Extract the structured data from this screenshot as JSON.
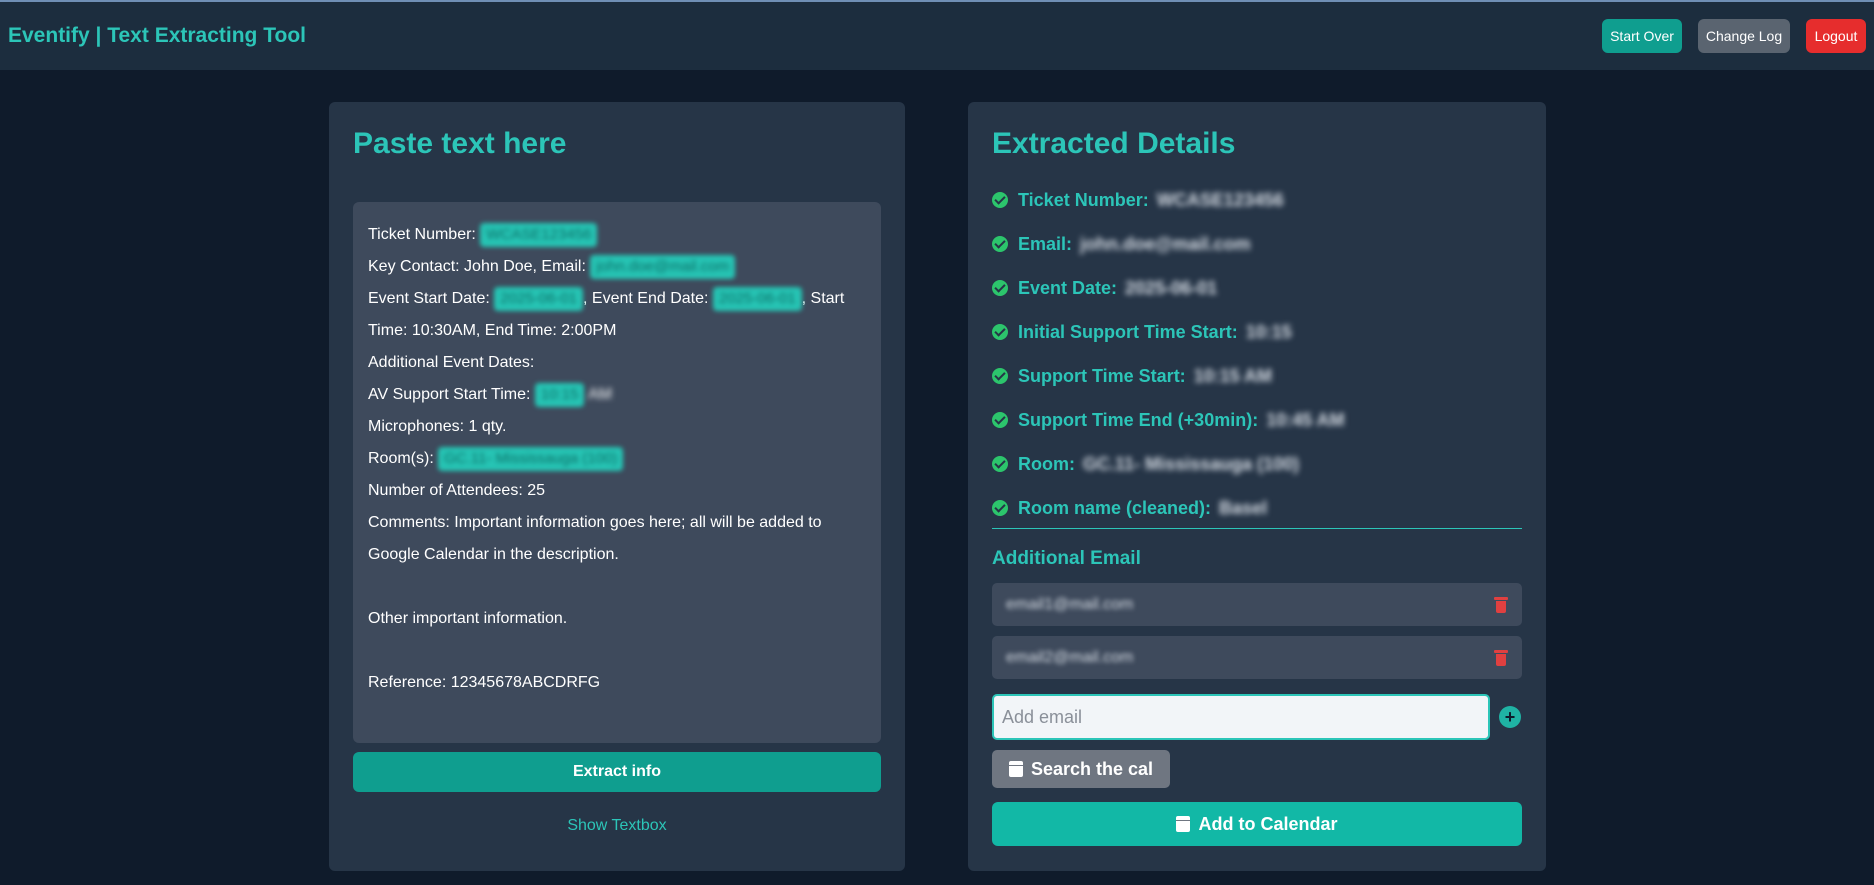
{
  "app": {
    "title": "Eventify | Text Extracting Tool"
  },
  "nav": {
    "start_over": "Start Over",
    "change_log": "Change Log",
    "logout": "Logout"
  },
  "left": {
    "title": "Paste text here",
    "lines": {
      "ticket_label": "Ticket Number:",
      "ticket_value": "WCASE123456",
      "contact_label": "Key Contact: John Doe, Email:",
      "contact_email": "john.doe@mail.com",
      "start_label": "Event Start Date:",
      "start_value": "2025-06-01",
      "end_label": ", Event End Date:",
      "end_value": "2025-06-01",
      "start_suffix": ", Start",
      "time_line": "Time: 10:30AM, End Time: 2:00PM",
      "additional_dates": "Additional Event Dates:",
      "av_label": "AV Support Start Time:",
      "av_value": "10:15",
      "av_suffix": "AM",
      "mics": "Microphones: 1 qty.",
      "rooms_label": "Room(s):",
      "rooms_value": "GC.11- Mississauga (100)",
      "attendees": "Number of Attendees: 25",
      "comments": "Comments: Important information goes here; all will be added to Google Calendar in the description.",
      "other": "Other important information.",
      "reference": "Reference: 12345678ABCDRFG"
    },
    "extract_button": "Extract info",
    "show_textbox": "Show Textbox"
  },
  "right": {
    "title": "Extracted Details",
    "details": [
      {
        "label": "Ticket Number:",
        "value": "WCASE123456"
      },
      {
        "label": "Email:",
        "value": "john.doe@mail.com"
      },
      {
        "label": "Event Date:",
        "value": "2025-06-01"
      },
      {
        "label": "Initial Support Time Start:",
        "value": "10:15"
      },
      {
        "label": "Support Time Start:",
        "value": "10:15 AM"
      },
      {
        "label": "Support Time End (+30min):",
        "value": "10:45 AM"
      },
      {
        "label": "Room:",
        "value": "GC.11- Mississauga (100)"
      },
      {
        "label": "Room name (cleaned):",
        "value": "Basel"
      }
    ],
    "additional_email_title": "Additional Email",
    "emails": [
      "email1@mail.com",
      "email2@mail.com"
    ],
    "add_email_placeholder": "Add email",
    "add_email_plus": "+",
    "search_button": "Search the cal",
    "add_calendar_button": "Add to Calendar"
  },
  "icons": {
    "check": "check-circle-icon",
    "trash": "trash-icon",
    "calendar": "calendar-icon",
    "plus": "plus-circle-icon"
  },
  "colors": {
    "accent": "#2cc5b8",
    "primary_button": "#0f9e8f",
    "danger": "#e62d2d",
    "check": "#2cc56c"
  }
}
